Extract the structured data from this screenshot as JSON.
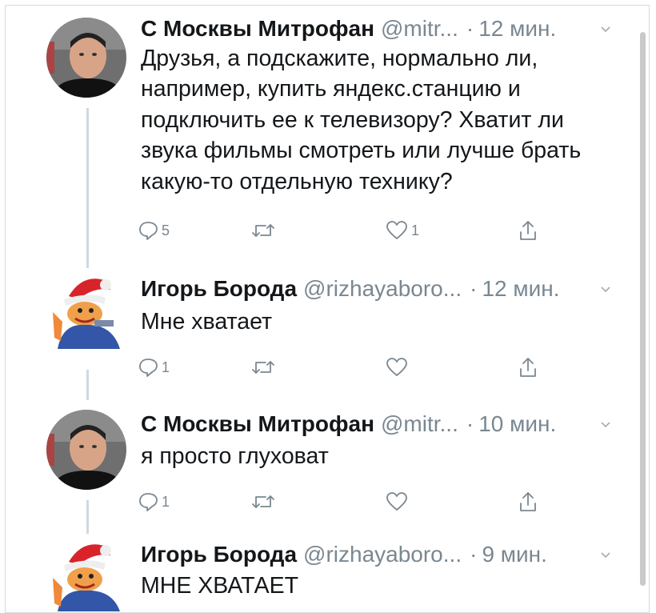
{
  "tweets": [
    {
      "name": "С Москвы Митрофан",
      "handle": "@mitr...",
      "time": "12 мин.",
      "text": "Друзья, а подскажите, нормально ли, например, купить яндекс.станцию и подключить ее к телевизору? Хватит ли звука фильмы смотреть или лучше брать какую-то отдельную технику?",
      "reply_count": "5",
      "like_count": "1"
    },
    {
      "name": "Игорь Борода",
      "handle": "@rizhayaboro...",
      "time": "12 мин.",
      "text": "Мне хватает",
      "reply_count": "1",
      "like_count": ""
    },
    {
      "name": "С Москвы Митрофан",
      "handle": "@mitr...",
      "time": "10 мин.",
      "text": "я просто глуховат",
      "reply_count": "1",
      "like_count": ""
    },
    {
      "name": "Игорь Борода",
      "handle": "@rizhayaboro...",
      "time": "9 мин.",
      "text": "МНЕ ХВАТАЕТ",
      "reply_count": "",
      "like_count": ""
    }
  ],
  "icons": {
    "reply": "reply-icon",
    "retweet": "retweet-icon",
    "like": "heart-icon",
    "share": "share-icon",
    "caret": "chevron-down-icon"
  },
  "colors": {
    "text": "#14171a",
    "secondary": "#7a8791",
    "thread_line": "#cfd9de"
  }
}
